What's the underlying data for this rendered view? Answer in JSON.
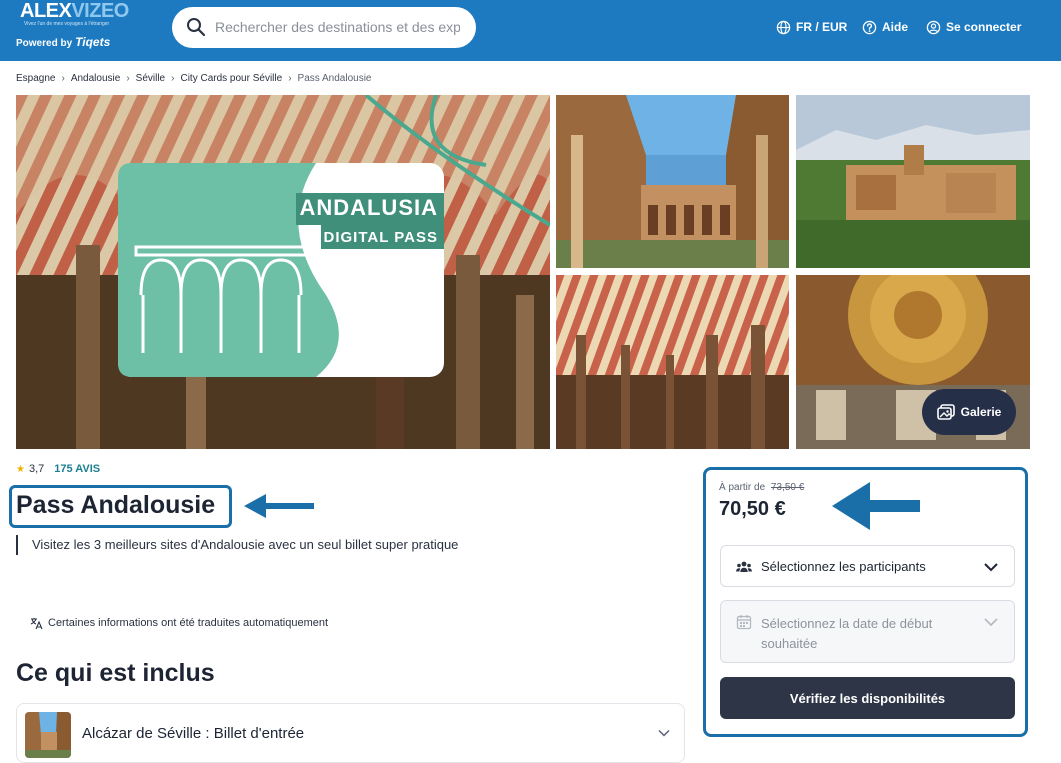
{
  "header": {
    "logo_main_a": "ALEX",
    "logo_main_b": "VIZEO",
    "logo_tagline": "Vivez l'un de mes voyages à l'étranger",
    "powered_label": "Powered by",
    "powered_brand": "Tiqets",
    "search_placeholder": "Rechercher des destinations et des expé",
    "lang_currency": "FR / EUR",
    "help": "Aide",
    "login": "Se connecter"
  },
  "breadcrumb": [
    "Espagne",
    "Andalousie",
    "Séville",
    "City Cards pour Séville",
    "Pass Andalousie"
  ],
  "gallery": {
    "pass_card_title": "ANDALUSIA",
    "pass_card_subtitle": "DIGITAL PASS",
    "galerie_button": "Galerie"
  },
  "rating": {
    "value": "3,7",
    "reviews": "175 AVIS"
  },
  "product": {
    "title": "Pass Andalousie",
    "subtitle": "Visitez les 3 meilleurs sites d'Andalousie avec un seul billet super pratique",
    "translated_note": "Certaines informations ont été traduites automatiquement"
  },
  "included": {
    "section_title": "Ce qui est inclus",
    "items": [
      {
        "label": "Alcázar de Séville : Billet d'entrée"
      }
    ]
  },
  "booking": {
    "from_label": "À partir de",
    "old_price": "73,50 €",
    "price": "70,50 €",
    "participants_label": "Sélectionnez les participants",
    "date_label": "Sélectionnez la date de début souhaitée",
    "check_button": "Vérifiez les disponibilités"
  },
  "colors": {
    "header_bg": "#1d7ac0",
    "highlight": "#1a6fa8",
    "rating_star": "#f0b400",
    "reviews_link": "#1a7f8e",
    "primary_button": "#2e3547",
    "card_green": "#6dbfa6"
  }
}
